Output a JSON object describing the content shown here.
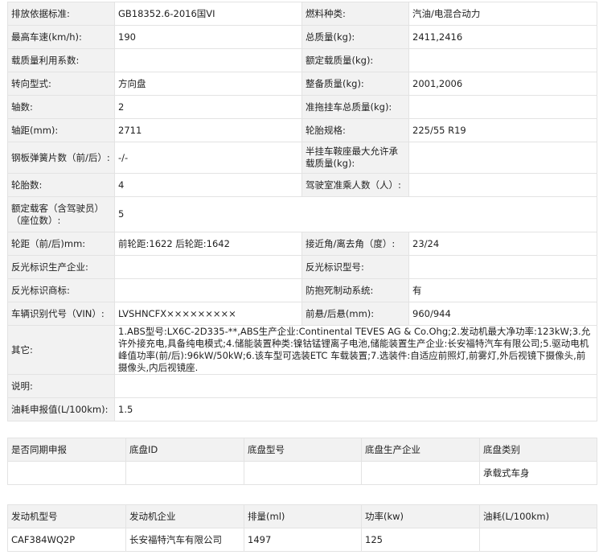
{
  "params": {
    "rows": [
      {
        "l1": "排放依据标准:",
        "v1": "GB18352.6-2016国VI",
        "l2": "燃料种类:",
        "v2": "汽油/电混合动力"
      },
      {
        "l1": "最高车速(km/h):",
        "v1": "190",
        "l2": "总质量(kg):",
        "v2": "2411,2416"
      },
      {
        "l1": "载质量利用系数:",
        "v1": "",
        "l2": "额定载质量(kg):",
        "v2": ""
      },
      {
        "l1": "转向型式:",
        "v1": "方向盘",
        "l2": "整备质量(kg):",
        "v2": "2001,2006"
      },
      {
        "l1": "轴数:",
        "v1": "2",
        "l2": "准拖挂车总质量(kg):",
        "v2": ""
      },
      {
        "l1": "轴距(mm):",
        "v1": "2711",
        "l2": "轮胎规格:",
        "v2": "225/55 R19"
      },
      {
        "l1": "钢板弹簧片数（前/后）:",
        "v1": "-/-",
        "l2": "半挂车鞍座最大允许承载质量(kg):",
        "v2": ""
      },
      {
        "l1": "轮胎数:",
        "v1": "4",
        "l2": "驾驶室准乘人数（人）:",
        "v2": ""
      }
    ],
    "seats": {
      "label": "额定载客（含驾驶员）（座位数）:",
      "value": "5"
    },
    "rows2": [
      {
        "l1": "轮距（前/后)mm:",
        "v1": "前轮距:1622 后轮距:1642",
        "l2": "接近角/离去角（度）:",
        "v2": "23/24"
      },
      {
        "l1": "反光标识生产企业:",
        "v1": "",
        "l2": "反光标识型号:",
        "v2": ""
      },
      {
        "l1": "反光标识商标:",
        "v1": "",
        "l2": "防抱死制动系统:",
        "v2": "有"
      },
      {
        "l1": "车辆识别代号（VIN）:",
        "v1": "LVSHNCFX×××××××××",
        "l2": "前悬/后悬(mm):",
        "v2": "960/944"
      }
    ],
    "other": {
      "label": "其它:",
      "value": "1.ABS型号:LX6C-2D335-**,ABS生产企业:Continental TEVES AG & Co.Ohg;2.发动机最大净功率:123kW;3.允许外接充电,具备纯电模式;4.储能装置种类:镍钴锰锂离子电池,储能装置生产企业:长安福特汽车有限公司;5.驱动电机峰值功率(前/后):96kW/50kW;6.该车型可选装ETC 车载装置;7.选装件:自适应前照灯,前雾灯,外后视镜下摄像头,前摄像头,内后视镜座."
    },
    "note": {
      "label": "说明:",
      "value": ""
    },
    "fuel": {
      "label": "油耗申报值(L/100km):",
      "value": "1.5"
    }
  },
  "chassis": {
    "headers": [
      "是否同期申报",
      "底盘ID",
      "底盘型号",
      "底盘生产企业",
      "底盘类别"
    ],
    "values": [
      "",
      "",
      "",
      "",
      "承载式车身"
    ]
  },
  "engine": {
    "headers": [
      "发动机型号",
      "发动机企业",
      "排量(ml)",
      "功率(kw)",
      "油耗(L/100km)"
    ],
    "values": [
      "CAF384WQ2P",
      "长安福特汽车有限公司",
      "1497",
      "125",
      ""
    ]
  }
}
